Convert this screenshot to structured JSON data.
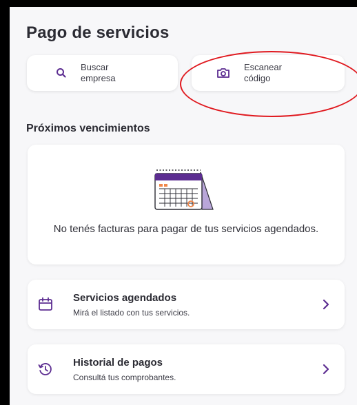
{
  "page": {
    "title": "Pago de servicios"
  },
  "actions": {
    "search": {
      "label": "Buscar empresa",
      "icon": "search-icon"
    },
    "scan": {
      "label": "Escanear código",
      "icon": "camera-icon"
    }
  },
  "upcoming": {
    "heading": "Próximos vencimientos",
    "empty_message": "No tenés facturas para pagar de tus servicios agendados.",
    "illustration": "calendar-illustration"
  },
  "menu": [
    {
      "title": "Servicios agendados",
      "subtitle": "Mirá el listado con tus servicios.",
      "icon": "calendar-icon"
    },
    {
      "title": "Historial de pagos",
      "subtitle": "Consultá tus comprobantes.",
      "icon": "history-icon"
    }
  ],
  "colors": {
    "accent": "#5c2d91",
    "annotation": "#e0191f",
    "background": "#f7f7f9"
  }
}
